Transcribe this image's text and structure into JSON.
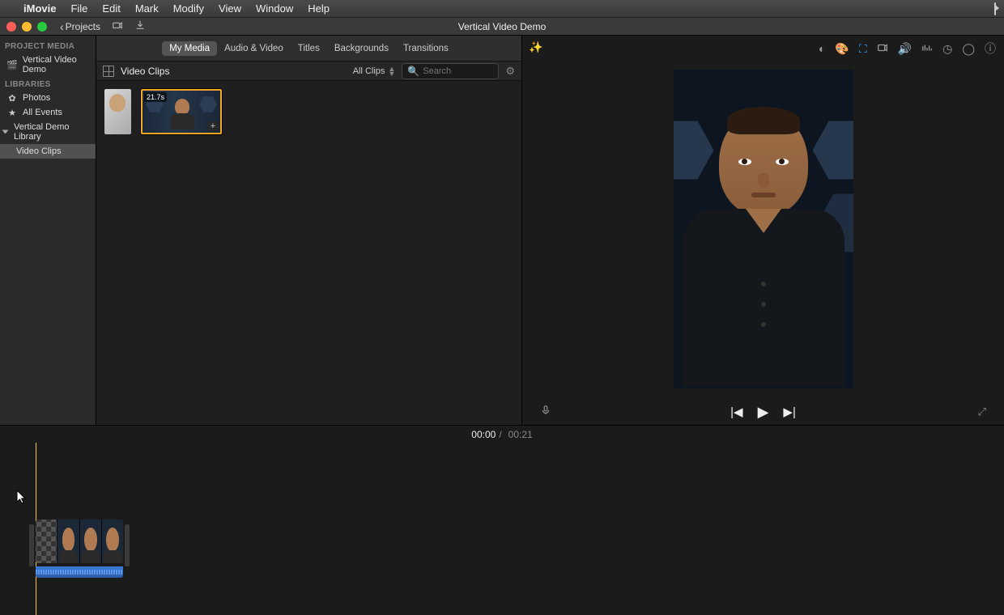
{
  "menubar": {
    "app": "iMovie",
    "items": [
      "File",
      "Edit",
      "Mark",
      "Modify",
      "View",
      "Window",
      "Help"
    ]
  },
  "toolbar": {
    "projects_label": "Projects",
    "window_title": "Vertical Video Demo"
  },
  "sidebar": {
    "section_project": "PROJECT MEDIA",
    "project_name": "Vertical Video Demo",
    "section_libraries": "LIBRARIES",
    "photos": "Photos",
    "all_events": "All Events",
    "library": "Vertical Demo Library",
    "video_clips": "Video Clips"
  },
  "media_tabs": {
    "my_media": "My Media",
    "audio_video": "Audio & Video",
    "titles": "Titles",
    "backgrounds": "Backgrounds",
    "transitions": "Transitions"
  },
  "media_subbar": {
    "title": "Video Clips",
    "filter": "All Clips",
    "search_placeholder": "Search"
  },
  "clips": {
    "main_duration": "21.7s"
  },
  "timecode": {
    "current": "00:00",
    "total": "00:21"
  },
  "colors": {
    "selection": "#f5a623",
    "playhead": "#f5c542",
    "crop_active": "#2e9bff"
  }
}
